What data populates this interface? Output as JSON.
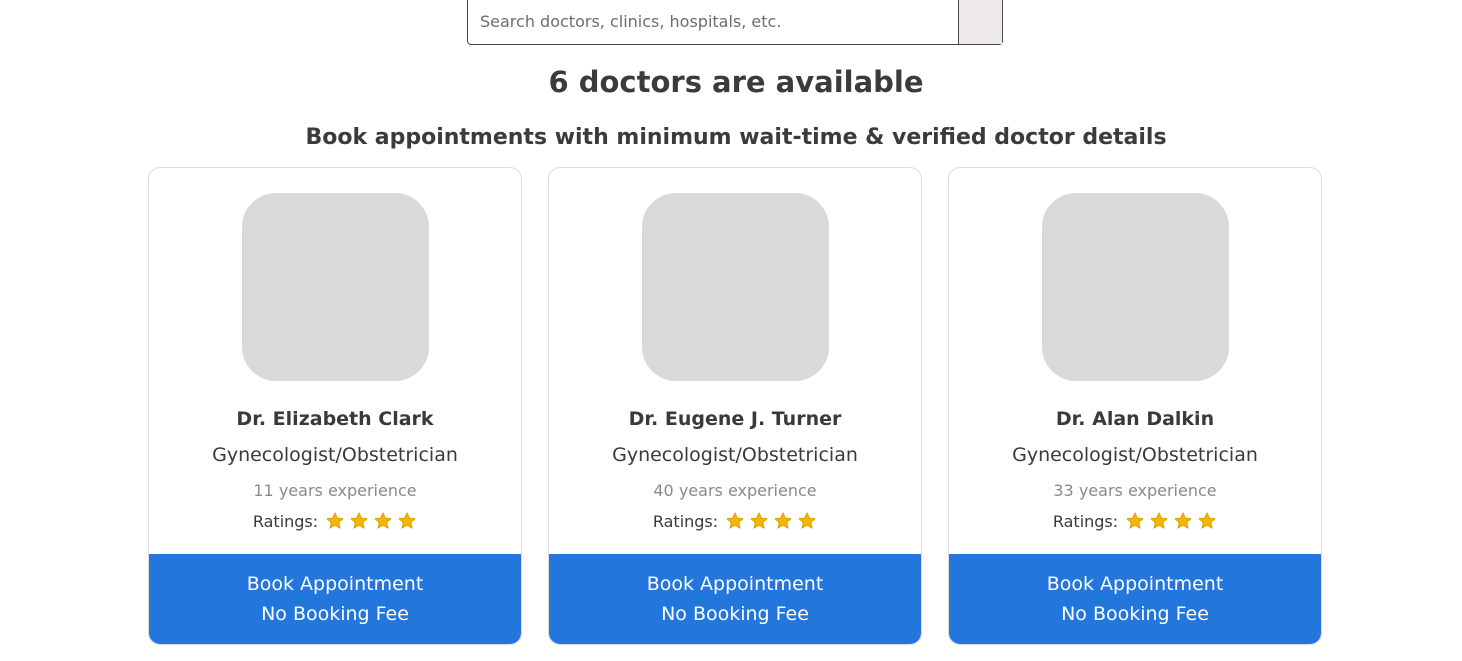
{
  "search": {
    "placeholder": "Search doctors, clinics, hospitals, etc."
  },
  "headline": "6 doctors are available",
  "subheadline": "Book appointments with minimum wait-time & verified doctor details",
  "colors": {
    "primary_button": "#2276dc",
    "photo_placeholder": "#d9d9d9",
    "star": "#f4b400"
  },
  "doctors": [
    {
      "name": "Dr. Elizabeth Clark",
      "specialty": "Gynecologist/Obstetrician",
      "experience": "11 years experience",
      "ratings_label": "Ratings:",
      "stars": 4,
      "button_line1": "Book Appointment",
      "button_line2": "No Booking Fee"
    },
    {
      "name": "Dr. Eugene J. Turner",
      "specialty": "Gynecologist/Obstetrician",
      "experience": "40 years experience",
      "ratings_label": "Ratings:",
      "stars": 4,
      "button_line1": "Book Appointment",
      "button_line2": "No Booking Fee"
    },
    {
      "name": "Dr. Alan Dalkin",
      "specialty": "Gynecologist/Obstetrician",
      "experience": "33 years experience",
      "ratings_label": "Ratings:",
      "stars": 4,
      "button_line1": "Book Appointment",
      "button_line2": "No Booking Fee"
    }
  ]
}
